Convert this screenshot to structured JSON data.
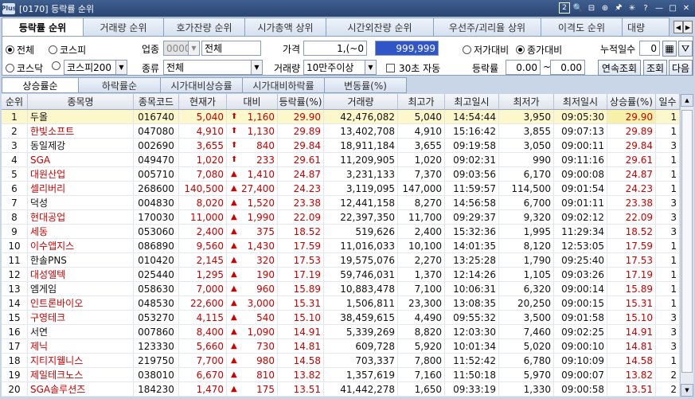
{
  "window": {
    "logo": "Plus",
    "title": "[0170] 등락률 순위"
  },
  "title_icons": [
    "2",
    "🔍",
    "⊟",
    "⊕",
    "🖈",
    "✳",
    "?",
    "—",
    "□",
    "✕"
  ],
  "tabs": [
    "등락률 순위",
    "거래량 순위",
    "호가잔량 순위",
    "시가총액 상위",
    "시간외잔량 순위",
    "우선주/괴리율 상위",
    "이격도 순위",
    "대량"
  ],
  "filters": {
    "market_all": "전체",
    "kospi": "코스피",
    "kosdaq": "코스닥",
    "kospi200": "코스피200",
    "sector_label": "업종",
    "sector_code": "0000",
    "sector_name": "전체",
    "price_label": "가격",
    "price_from": "1,(~0",
    "price_to": "999,999",
    "vs_low": "저가대비",
    "vs_close": "종가대비",
    "cum_days_label": "누적일수",
    "cum_days": "0",
    "type_label": "종류",
    "type_value": "전체",
    "volume_label": "거래량",
    "volume_value": "10만주이상",
    "auto_label": "30초 자동",
    "rate_label": "등락률",
    "rate_from": "0.00",
    "rate_tilde": "~",
    "rate_to": "0.00",
    "btn_continuous": "연속조회",
    "btn_query": "조회",
    "btn_next": "다음"
  },
  "subtabs": [
    "상승률순",
    "하락률순",
    "시가대비상승률",
    "시가대비하락률",
    "변동률(%)"
  ],
  "columns": [
    "순위",
    "종목명",
    "종목코드",
    "현재가",
    "대비",
    "등락률(%)",
    "거래량",
    "최고가",
    "최고일시",
    "최저가",
    "최저일시",
    "상승률(%)",
    "일수"
  ],
  "rows": [
    {
      "rank": "1",
      "name": "두올",
      "code": "016740",
      "price": "5,040",
      "sign": "⬆",
      "diff": "1,160",
      "rate": "29.90",
      "volume": "42,476,082",
      "high": "5,040",
      "high_time": "14:54:44",
      "low": "3,950",
      "low_time": "09:05:30",
      "up_rate": "29.90",
      "days": "1"
    },
    {
      "rank": "2",
      "name": "한빛소프트",
      "code": "047080",
      "price": "4,910",
      "sign": "⬆",
      "diff": "1,130",
      "rate": "29.89",
      "volume": "13,402,708",
      "high": "4,910",
      "high_time": "15:16:42",
      "low": "3,855",
      "low_time": "09:07:13",
      "up_rate": "29.89",
      "days": "1"
    },
    {
      "rank": "3",
      "name": "동일제강",
      "code": "002690",
      "price": "3,655",
      "sign": "⬆",
      "diff": "840",
      "rate": "29.84",
      "volume": "18,911,184",
      "high": "3,655",
      "high_time": "09:19:58",
      "low": "3,050",
      "low_time": "09:00:11",
      "up_rate": "29.84",
      "days": "3"
    },
    {
      "rank": "4",
      "name": "SGA",
      "code": "049470",
      "price": "1,020",
      "sign": "⬆",
      "diff": "233",
      "rate": "29.61",
      "volume": "11,209,905",
      "high": "1,020",
      "high_time": "09:02:31",
      "low": "990",
      "low_time": "09:11:16",
      "up_rate": "29.61",
      "days": "1"
    },
    {
      "rank": "5",
      "name": "대원산업",
      "code": "005710",
      "price": "7,080",
      "sign": "▲",
      "diff": "1,410",
      "rate": "24.87",
      "volume": "3,231,133",
      "high": "7,370",
      "high_time": "09:03:56",
      "low": "6,170",
      "low_time": "09:00:08",
      "up_rate": "24.87",
      "days": "1"
    },
    {
      "rank": "6",
      "name": "셀리버리",
      "code": "268600",
      "price": "140,500",
      "sign": "▲",
      "diff": "27,400",
      "rate": "24.23",
      "volume": "3,119,095",
      "high": "147,000",
      "high_time": "11:59:57",
      "low": "114,500",
      "low_time": "09:01:54",
      "up_rate": "24.23",
      "days": "1"
    },
    {
      "rank": "7",
      "name": "덕성",
      "code": "004830",
      "price": "8,020",
      "sign": "▲",
      "diff": "1,520",
      "rate": "23.38",
      "volume": "12,441,158",
      "high": "8,270",
      "high_time": "14:56:58",
      "low": "6,700",
      "low_time": "09:01:11",
      "up_rate": "23.38",
      "days": "3"
    },
    {
      "rank": "8",
      "name": "현대공업",
      "code": "170030",
      "price": "11,000",
      "sign": "▲",
      "diff": "1,990",
      "rate": "22.09",
      "volume": "22,397,350",
      "high": "11,700",
      "high_time": "09:29:37",
      "low": "9,320",
      "low_time": "09:02:12",
      "up_rate": "22.09",
      "days": "3"
    },
    {
      "rank": "9",
      "name": "세동",
      "code": "053060",
      "price": "2,400",
      "sign": "▲",
      "diff": "375",
      "rate": "18.52",
      "volume": "519,626",
      "high": "2,400",
      "high_time": "15:32:36",
      "low": "1,995",
      "low_time": "11:29:34",
      "up_rate": "18.52",
      "days": "3"
    },
    {
      "rank": "10",
      "name": "이수앱지스",
      "code": "086890",
      "price": "9,560",
      "sign": "▲",
      "diff": "1,430",
      "rate": "17.59",
      "volume": "11,016,033",
      "high": "10,100",
      "high_time": "14:01:35",
      "low": "8,120",
      "low_time": "12:53:05",
      "up_rate": "17.59",
      "days": "1"
    },
    {
      "rank": "11",
      "name": "한솔PNS",
      "code": "010420",
      "price": "2,145",
      "sign": "▲",
      "diff": "320",
      "rate": "17.53",
      "volume": "19,575,076",
      "high": "2,270",
      "high_time": "13:25:28",
      "low": "1,790",
      "low_time": "09:25:40",
      "up_rate": "17.53",
      "days": "1"
    },
    {
      "rank": "12",
      "name": "대성엘텍",
      "code": "025440",
      "price": "1,295",
      "sign": "▲",
      "diff": "190",
      "rate": "17.19",
      "volume": "59,746,031",
      "high": "1,370",
      "high_time": "12:14:26",
      "low": "1,105",
      "low_time": "09:03:26",
      "up_rate": "17.19",
      "days": "1"
    },
    {
      "rank": "13",
      "name": "엠게임",
      "code": "058630",
      "price": "7,000",
      "sign": "▲",
      "diff": "960",
      "rate": "15.89",
      "volume": "10,883,478",
      "high": "7,100",
      "high_time": "10:06:31",
      "low": "6,320",
      "low_time": "09:00:14",
      "up_rate": "15.89",
      "days": "1"
    },
    {
      "rank": "14",
      "name": "인트론바이오",
      "code": "048530",
      "price": "22,600",
      "sign": "▲",
      "diff": "3,000",
      "rate": "15.31",
      "volume": "1,506,811",
      "high": "23,300",
      "high_time": "13:08:35",
      "low": "20,250",
      "low_time": "09:00:15",
      "up_rate": "15.31",
      "days": "1"
    },
    {
      "rank": "15",
      "name": "구영테크",
      "code": "053270",
      "price": "4,115",
      "sign": "▲",
      "diff": "540",
      "rate": "15.10",
      "volume": "38,459,615",
      "high": "4,490",
      "high_time": "09:55:32",
      "low": "3,500",
      "low_time": "09:01:58",
      "up_rate": "15.10",
      "days": "3"
    },
    {
      "rank": "16",
      "name": "서연",
      "code": "007860",
      "price": "8,400",
      "sign": "▲",
      "diff": "1,090",
      "rate": "14.91",
      "volume": "5,339,269",
      "high": "8,820",
      "high_time": "12:03:30",
      "low": "7,460",
      "low_time": "09:02:25",
      "up_rate": "14.91",
      "days": "3"
    },
    {
      "rank": "17",
      "name": "제닉",
      "code": "123330",
      "price": "5,660",
      "sign": "▲",
      "diff": "730",
      "rate": "14.81",
      "volume": "609,728",
      "high": "5,920",
      "high_time": "10:01:34",
      "low": "5,020",
      "low_time": "09:00:10",
      "up_rate": "14.81",
      "days": "3"
    },
    {
      "rank": "18",
      "name": "지티지웰니스",
      "code": "219750",
      "price": "7,700",
      "sign": "▲",
      "diff": "980",
      "rate": "14.58",
      "volume": "703,337",
      "high": "7,800",
      "high_time": "11:52:42",
      "low": "6,780",
      "low_time": "09:10:09",
      "up_rate": "14.58",
      "days": "1"
    },
    {
      "rank": "19",
      "name": "제일테크노스",
      "code": "038010",
      "price": "6,670",
      "sign": "▲",
      "diff": "810",
      "rate": "13.82",
      "volume": "1,357,619",
      "high": "7,160",
      "high_time": "11:50:18",
      "low": "5,970",
      "low_time": "09:00:07",
      "up_rate": "13.82",
      "days": "2"
    },
    {
      "rank": "20",
      "name": "SGA솔루션즈",
      "code": "184230",
      "price": "1,470",
      "sign": "▲",
      "diff": "175",
      "rate": "13.51",
      "volume": "41,442,278",
      "high": "1,650",
      "high_time": "09:33:19",
      "low": "1,330",
      "low_time": "09:00:58",
      "up_rate": "13.51",
      "days": "2"
    }
  ],
  "colors": {
    "up": "#cc0000",
    "highlight_row": "#fdf8cc",
    "selected_input": "#2f55c9"
  }
}
